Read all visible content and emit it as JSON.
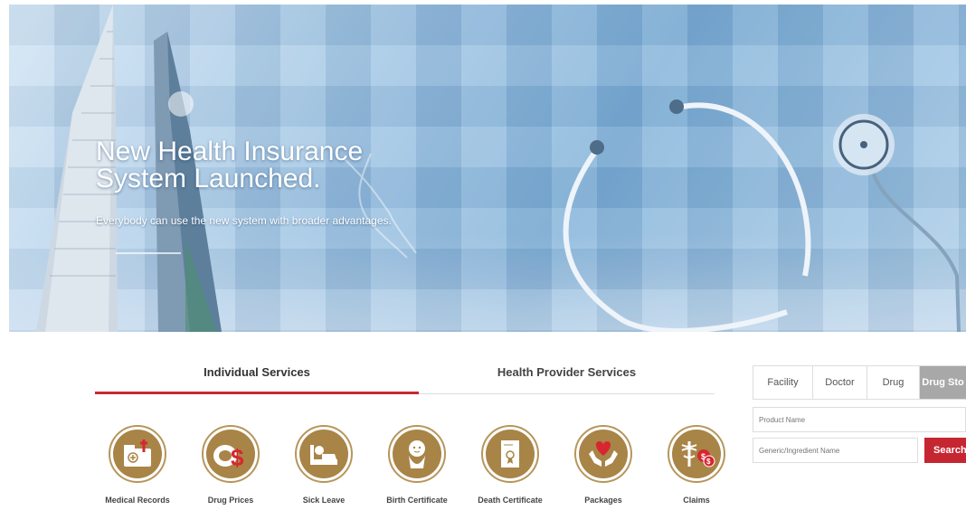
{
  "hero": {
    "title": "New Health Insurance System Launched.",
    "subtitle": "Everybody can use the new system with broader advantages."
  },
  "service_tabs": [
    {
      "label": "Individual Services",
      "active": true
    },
    {
      "label": "Health Provider Services",
      "active": false
    }
  ],
  "services": [
    {
      "label": "Medical Records",
      "icon": "medical-records-icon"
    },
    {
      "label": "Drug Prices",
      "icon": "drug-prices-icon"
    },
    {
      "label": "Sick Leave",
      "icon": "sick-leave-icon"
    },
    {
      "label": "Birth Certificate",
      "icon": "birth-certificate-icon"
    },
    {
      "label": "Death Certificate",
      "icon": "death-certificate-icon"
    },
    {
      "label": "Packages",
      "icon": "packages-icon"
    },
    {
      "label": "Claims",
      "icon": "claims-icon"
    }
  ],
  "search": {
    "tabs": [
      "Facility",
      "Doctor",
      "Drug",
      "Drug Sto"
    ],
    "active_tab": "Drug Sto",
    "product_placeholder": "Product Name",
    "generic_placeholder": "Generic/Ingredient Name",
    "button_label": "Search"
  },
  "colors": {
    "accent_red": "#c52a35",
    "gold": "#a88447",
    "active_tab_gray": "#a8a8a8"
  }
}
